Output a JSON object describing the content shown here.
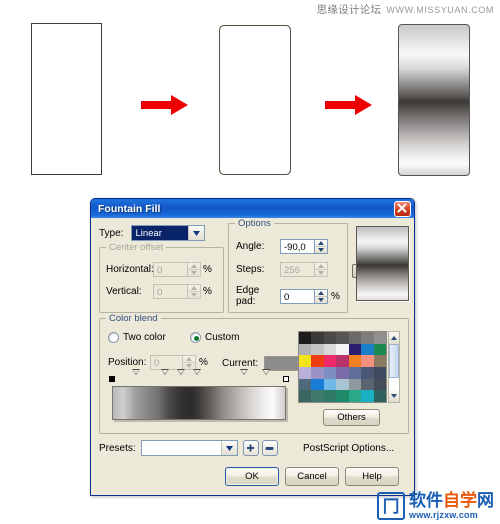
{
  "watermarks": {
    "top_cn": "思缘设计论坛",
    "top_url": "WWW.MISSYUAN.COM",
    "bottom_logo_glyph": "冂",
    "bottom_cn_1": "软件",
    "bottom_cn_2": "自学",
    "bottom_cn_3": "网",
    "bottom_url": "www.rjzxw.com"
  },
  "illustration": {
    "step1_name": "plain-rectangle",
    "step2_name": "selected-rectangle",
    "step3_name": "gradient-filled-rectangle",
    "arrow1_name": "red-arrow",
    "arrow2_name": "red-arrow"
  },
  "dialog": {
    "title": "Fountain Fill",
    "close_label": "✕",
    "type": {
      "label": "Type:",
      "value": "Linear"
    },
    "center_offset": {
      "legend": "Center offset",
      "horizontal_label": "Horizontal:",
      "horizontal_value": "0",
      "horizontal_unit": "%",
      "vertical_label": "Vertical:",
      "vertical_value": "0",
      "vertical_unit": "%"
    },
    "options": {
      "legend": "Options",
      "angle_label": "Angle:",
      "angle_value": "-90,0",
      "steps_label": "Steps:",
      "steps_value": "256",
      "edge_pad_label": "Edge pad:",
      "edge_pad_value": "0",
      "edge_pad_unit": "%"
    },
    "color_blend": {
      "legend": "Color blend",
      "two_color_label": "Two color",
      "custom_label": "Custom",
      "selected": "Custom",
      "position_label": "Position:",
      "position_value": "0",
      "position_unit": "%",
      "current_label": "Current:",
      "current_swatch": "#8c8c8c",
      "others_label": "Others",
      "markers": [
        {
          "name": "start-marker",
          "pos": 0,
          "kind": "square-black"
        },
        {
          "name": "node-marker",
          "pos": 14,
          "kind": "triangle"
        },
        {
          "name": "node-marker",
          "pos": 31,
          "kind": "triangle"
        },
        {
          "name": "node-marker",
          "pos": 40,
          "kind": "triangle"
        },
        {
          "name": "node-marker",
          "pos": 49,
          "kind": "triangle"
        },
        {
          "name": "node-marker",
          "pos": 76,
          "kind": "triangle"
        },
        {
          "name": "node-marker",
          "pos": 89,
          "kind": "triangle"
        },
        {
          "name": "end-marker",
          "pos": 100,
          "kind": "square-white"
        }
      ],
      "palette": [
        [
          "#1c1c1c",
          "#3a3a3a",
          "#4a4a4a",
          "#565656",
          "#6a6a6a",
          "#7d7d7d",
          "#909090"
        ],
        [
          "#b1b1b1",
          "#c4c4c4",
          "#d9d9d9",
          "#f3f3f3",
          "#2a1e6e",
          "#1a7ec8",
          "#1a8a4e"
        ],
        [
          "#f5e41a",
          "#ef3d13",
          "#ef2a6b",
          "#b8336a",
          "#f08020",
          "#f49080",
          "#8a7a62"
        ],
        [
          "#b8b0d8",
          "#9a93c8",
          "#7d8fc0",
          "#7a6aa8",
          "#5f6f9a",
          "#4a5876",
          "#3f4a5e"
        ],
        [
          "#4f6a7a",
          "#1a7ed8",
          "#6fb8e8",
          "#a8c4d4",
          "#8f9aa0",
          "#5a6470",
          "#454e58"
        ],
        [
          "#3a6660",
          "#3f7a6c",
          "#2f7a66",
          "#1f8a6a",
          "#2aa88a",
          "#19b0c4",
          "#30605e"
        ]
      ]
    },
    "presets": {
      "label": "Presets:",
      "value": "",
      "add_label": "+",
      "remove_label": "−"
    },
    "postscript_label": "PostScript Options...",
    "buttons": {
      "ok": "OK",
      "cancel": "Cancel",
      "help": "Help"
    }
  }
}
